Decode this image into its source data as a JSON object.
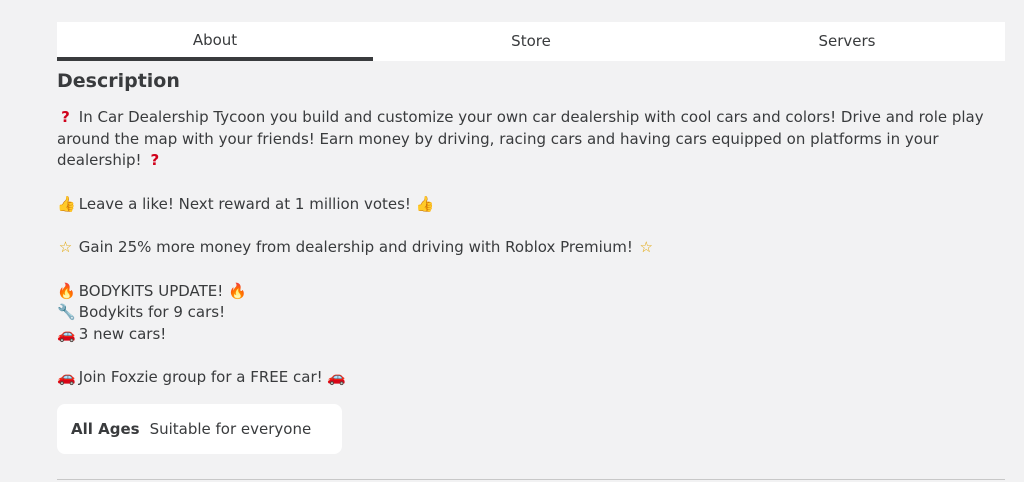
{
  "tabs": [
    {
      "label": "About",
      "active": true
    },
    {
      "label": "Store",
      "active": false
    },
    {
      "label": "Servers",
      "active": false
    }
  ],
  "section_title": "Description",
  "description": {
    "intro": {
      "icon": "question-mark-icon",
      "text": "In Car Dealership Tycoon you build and customize your own car dealership with cool cars and colors! Drive and role play around the map with your friends! Earn money by driving, racing cars and having cars equipped on platforms in your dealership!"
    },
    "like_line": {
      "icon": "thumbs-up-icon",
      "text": "Leave a like! Next reward at 1 million votes!"
    },
    "premium_line": {
      "icon": "star-icon",
      "text": "Gain 25% more money from dealership and driving with Roblox Premium!"
    },
    "update_line": {
      "icon": "fire-icon",
      "text": "BODYKITS UPDATE!"
    },
    "bodykits_line": {
      "icon": "wrench-icon",
      "text": "Bodykits for 9 cars!"
    },
    "cars_line": {
      "icon": "car-icon",
      "text": "3 new cars!"
    },
    "group_line": {
      "icon": "car-icon",
      "text": "Join Foxzie group for a FREE car!"
    }
  },
  "age_rating": {
    "label": "All Ages",
    "description": "Suitable for everyone"
  },
  "colors": {
    "background": "#f2f2f3",
    "text": "#393b3d",
    "tab_background": "#ffffff",
    "active_tab_underline": "#393b3d"
  }
}
